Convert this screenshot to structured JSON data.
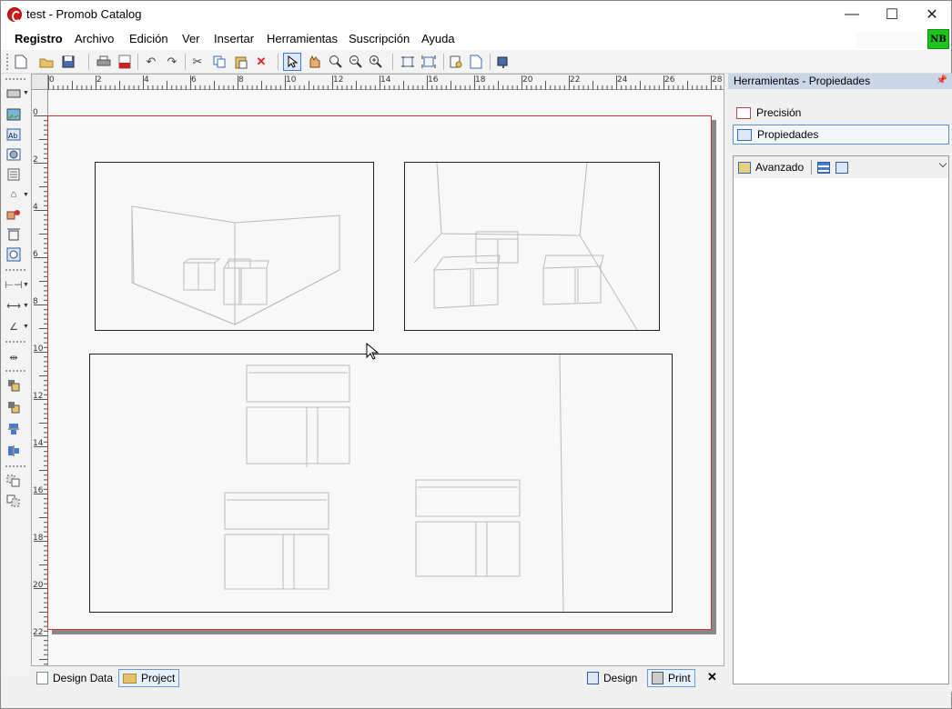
{
  "window": {
    "title": "test - Promob Catalog",
    "minimize": "—",
    "maximize": "☐",
    "close": "✕"
  },
  "menu": [
    "Registro",
    "Archivo",
    "Edición",
    "Ver",
    "Insertar",
    "Herramientas",
    "Suscripción",
    "Ayuda"
  ],
  "user": {
    "badge": "NB",
    "badge_color": "#1ec41e"
  },
  "toolbar": {
    "icons": [
      "new-icon",
      "open-folder-icon",
      "save-icon",
      "print-icon",
      "pdf-icon",
      "undo-icon",
      "redo-icon",
      "cut-icon",
      "copy-icon",
      "paste-icon",
      "delete-icon",
      "select-arrow-icon",
      "pan-hand-icon",
      "zoom-area-icon",
      "zoom-out-icon",
      "zoom-in-icon",
      "fit-page-icon",
      "fit-width-icon",
      "page-setup-icon",
      "blank-page-icon",
      "export-icon"
    ]
  },
  "ruler": {
    "h_numbers": [
      "0",
      "2",
      "4",
      "6",
      "8",
      "10",
      "12",
      "14",
      "16",
      "18",
      "20",
      "22",
      "24",
      "26",
      "28"
    ],
    "v_numbers": [
      "0",
      "2",
      "4",
      "6",
      "8",
      "10",
      "12",
      "14",
      "16",
      "18",
      "20",
      "22"
    ]
  },
  "bottom_tabs": {
    "design_data": "Design Data",
    "project": "Project",
    "design": "Design",
    "print": "Print",
    "close": "✕"
  },
  "right_panel": {
    "title": "Herramientas - Propiedades",
    "precision": "Precisión",
    "properties": "Propiedades",
    "advanced": "Avanzado"
  },
  "colors": {
    "page_border": "#cc3333",
    "panel_header": "#c8d6e8",
    "selection": "#3b7ad8"
  }
}
